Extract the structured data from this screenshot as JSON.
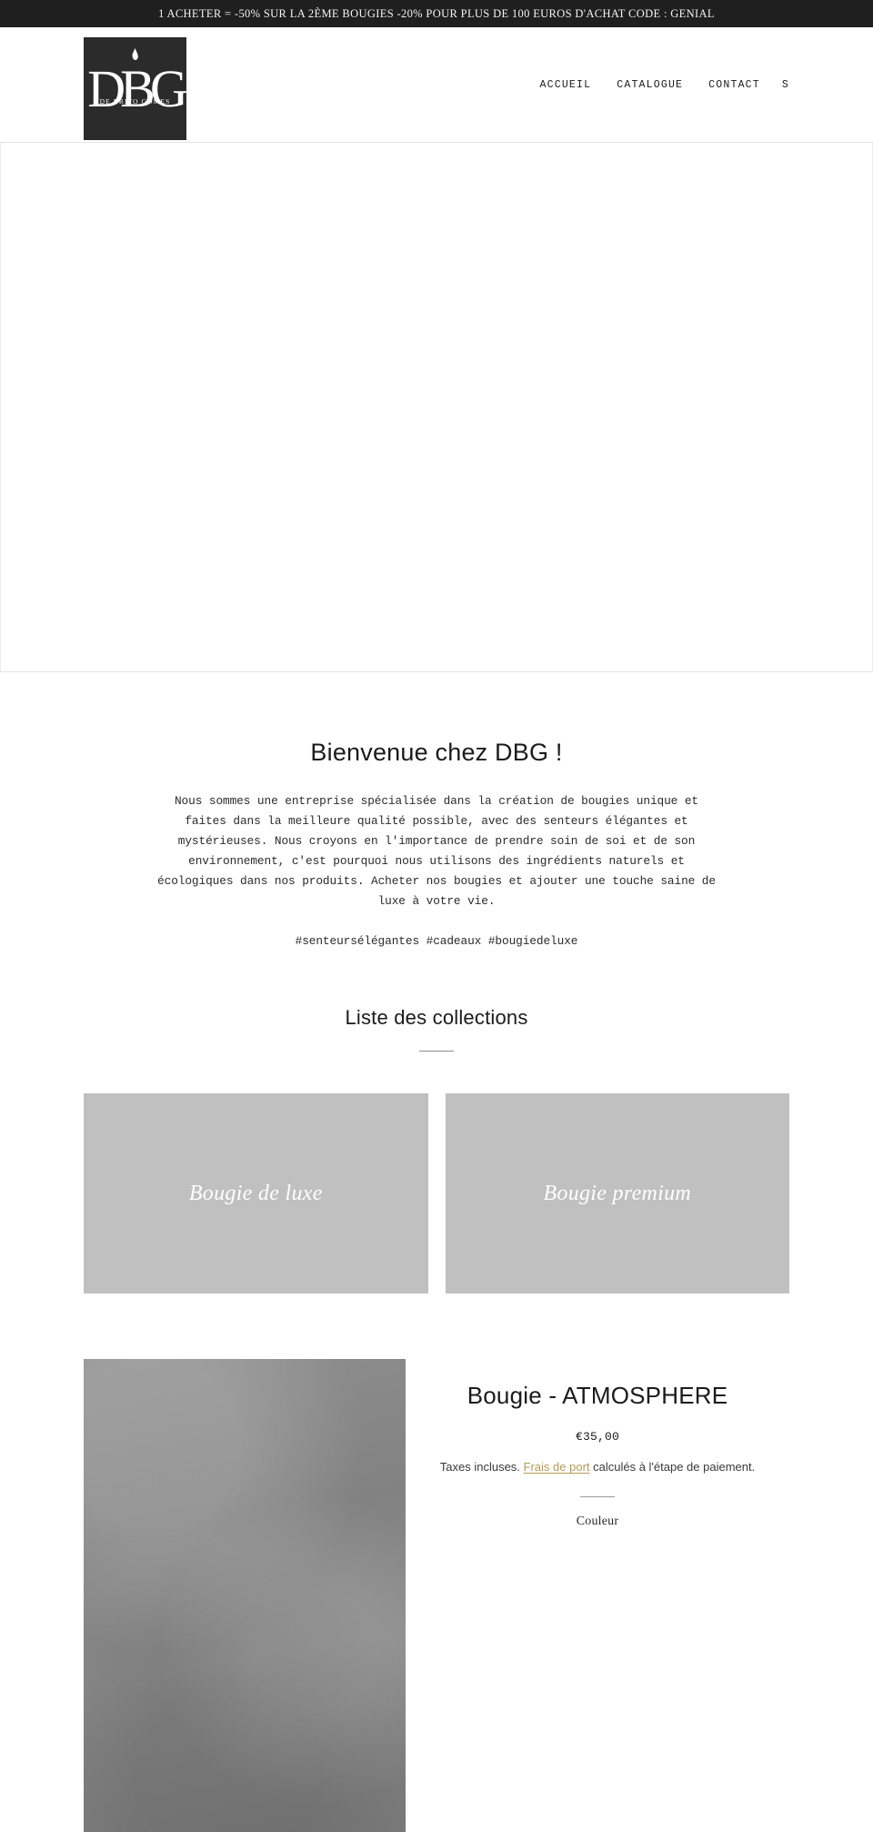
{
  "announcement": {
    "text": "1 ACHETER = -50% SUR LA 2ÈME BOUGIES -20% POUR PLUS DE 100 EUROS D'ACHAT CODE : GENIAL"
  },
  "header": {
    "logo": {
      "monogram": "DBG",
      "subtitle": "DE BRITO GOMES",
      "icon": "flame-icon"
    },
    "nav": [
      {
        "label": "ACCUEIL"
      },
      {
        "label": "CATALOGUE"
      },
      {
        "label": "CONTACT"
      }
    ],
    "search_label": "S"
  },
  "welcome": {
    "heading": "Bienvenue chez DBG !",
    "body": "Nous sommes une entreprise spécialisée dans la création de bougies unique et faites dans la meilleure qualité possible, avec des senteurs élégantes et mystérieuses. Nous croyons en l'importance de prendre soin de soi et de son environnement, c'est pourquoi nous utilisons des ingrédients naturels et écologiques dans nos produits. Acheter nos bougies et ajouter une touche saine de luxe à votre vie.",
    "tags": "#senteursélégantes #cadeaux #bougiedeluxe"
  },
  "collections": {
    "heading": "Liste des collections",
    "items": [
      {
        "title": "Bougie de luxe"
      },
      {
        "title": "Bougie premium"
      }
    ]
  },
  "product": {
    "title": "Bougie - ATMOSPHERE",
    "price": "€35,00",
    "tax_prefix": "Taxes incluses. ",
    "shipping_link": "Frais de port",
    "tax_suffix": " calculés à l'étape de paiement.",
    "variant_label": "Couleur"
  },
  "colors": {
    "announcement_bg": "#1f1f1f",
    "logo_bg": "#2b2b2b",
    "collection_card_bg": "#c0c0c0",
    "shipping_link": "#b39b5c",
    "text": "#1c1b1b"
  }
}
